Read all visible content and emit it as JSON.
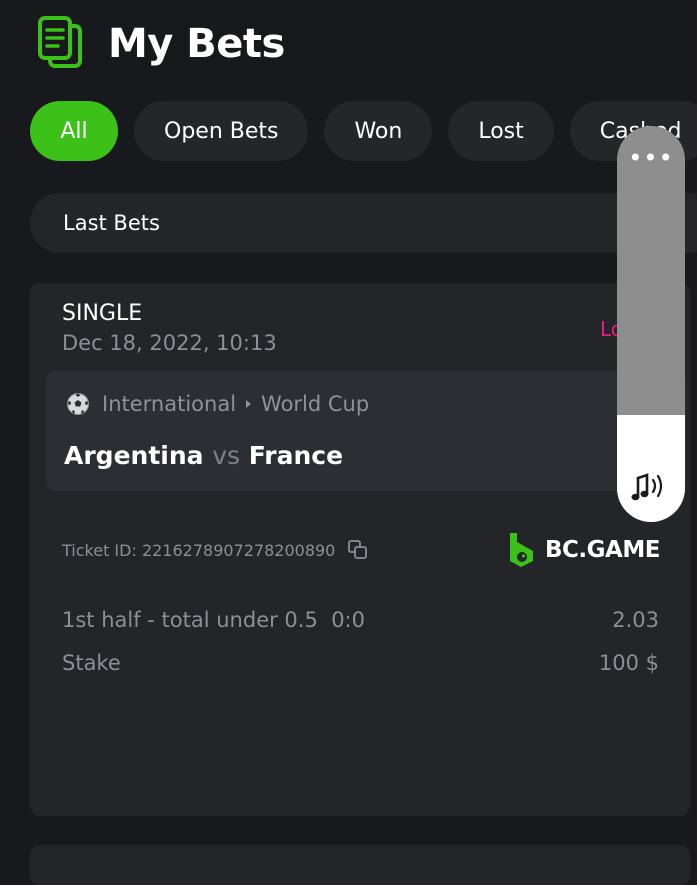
{
  "header": {
    "title": "My Bets",
    "icon": "document-icon"
  },
  "filters": [
    {
      "label": "All",
      "active": true
    },
    {
      "label": "Open Bets",
      "active": false
    },
    {
      "label": "Won",
      "active": false
    },
    {
      "label": "Lost",
      "active": false
    },
    {
      "label": "Cashed",
      "active": false
    }
  ],
  "last_bets": {
    "label": "Last Bets"
  },
  "bet": {
    "type": "SINGLE",
    "date": "Dec 18, 2022, 10:13",
    "status": "Lost",
    "league": {
      "region": "International",
      "competition": "World Cup"
    },
    "team_home": "Argentina",
    "vs": "vs",
    "team_away": "France",
    "ticket": "Ticket ID: 2216278907278200890",
    "brand": "BC.GAME",
    "market": "1st half - total under 0.5",
    "score": "0:0",
    "odds": "2.03",
    "stake_label": "Stake",
    "stake_value": "100 $"
  },
  "volume_overlay": {
    "more": "•••",
    "level": 0.27,
    "icon": "music-speaker-icon"
  },
  "colors": {
    "accent": "#3bc117",
    "lost": "#ed1b81",
    "background": "#18191c",
    "card": "#232529"
  }
}
